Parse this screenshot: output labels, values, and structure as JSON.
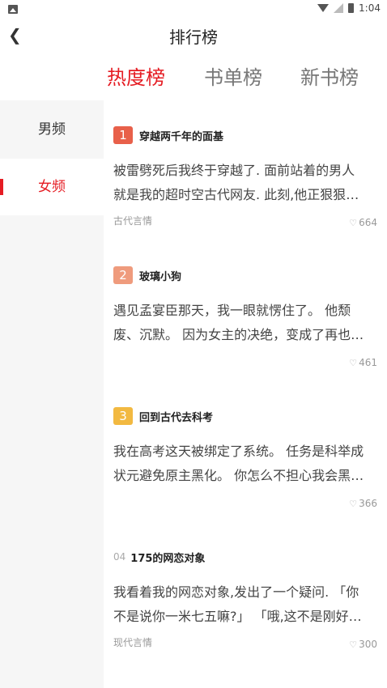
{
  "status_bar": {
    "time": "1:04"
  },
  "header": {
    "title": "排行榜"
  },
  "tabs": [
    {
      "label": "热度榜",
      "active": true
    },
    {
      "label": "书单榜",
      "active": false
    },
    {
      "label": "新书榜",
      "active": false
    }
  ],
  "sidebar": {
    "items": [
      {
        "label": "男频",
        "active": false
      },
      {
        "label": "女频",
        "active": true
      }
    ]
  },
  "books": [
    {
      "rank": "1",
      "title": "穿越两千年的面基",
      "desc_line1": "被雷劈死后我终于穿越了. 面前站着的男人",
      "desc_line2": "就是我的超时空古代网友. 此刻,他正狠狠…",
      "tag": "古代言情",
      "likes": "664"
    },
    {
      "rank": "2",
      "title": "玻璃小狗",
      "desc_line1": "遇见孟宴臣那天，我一眼就愣住了。 他颓",
      "desc_line2": "废、沉默。 因为女主的决绝，变成了再也…",
      "tag": "",
      "likes": "461"
    },
    {
      "rank": "3",
      "title": "回到古代去科考",
      "desc_line1": "我在高考这天被绑定了系统。 任务是科举成",
      "desc_line2": "状元避免原主黑化。 你怎么不担心我会黑…",
      "tag": "",
      "likes": "366"
    },
    {
      "rank": "04",
      "title": "175的网恋对象",
      "desc_line1": "我看着我的网恋对象,发出了一个疑问. 「你",
      "desc_line2": "不是说你一米七五嘛?」 「哦,这不是刚好…",
      "tag": "现代言情",
      "likes": "300"
    }
  ],
  "colors": {
    "accent": "#e51c23",
    "rank1": "#e8604a",
    "rank2": "#ef9b7d",
    "rank3": "#f2b941"
  },
  "icons": {
    "back": "chevron-left-icon",
    "like": "heart-outline-icon"
  }
}
